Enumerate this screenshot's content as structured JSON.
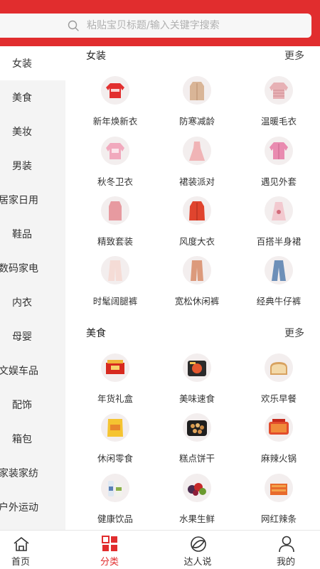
{
  "colors": {
    "accent": "#e12d2e",
    "sidebar_bg": "#f4f4f4"
  },
  "search": {
    "placeholder": "粘贴宝贝标题/输入关键字搜索"
  },
  "sidebar": {
    "items": [
      {
        "label": "女装",
        "active": true
      },
      {
        "label": "美食"
      },
      {
        "label": "美妆"
      },
      {
        "label": "男装"
      },
      {
        "label": "居家日用"
      },
      {
        "label": "鞋品"
      },
      {
        "label": "数码家电"
      },
      {
        "label": "内衣"
      },
      {
        "label": "母婴"
      },
      {
        "label": "文娱车品"
      },
      {
        "label": "配饰"
      },
      {
        "label": "箱包"
      },
      {
        "label": "家装家纺"
      },
      {
        "label": "户外运动"
      }
    ]
  },
  "sections": [
    {
      "title": "女装",
      "more": "更多",
      "items": [
        {
          "label": "新年焕新衣",
          "icon": "red-sweater-icon"
        },
        {
          "label": "防寒减龄",
          "icon": "beige-coat-icon"
        },
        {
          "label": "温暖毛衣",
          "icon": "pink-knit-sweater-icon"
        },
        {
          "label": "秋冬卫衣",
          "icon": "pink-hoodie-icon"
        },
        {
          "label": "裙装派对",
          "icon": "pink-dress-icon"
        },
        {
          "label": "遇见外套",
          "icon": "pink-jacket-icon"
        },
        {
          "label": "精致套装",
          "icon": "pink-suit-icon"
        },
        {
          "label": "风度大衣",
          "icon": "red-coat-icon"
        },
        {
          "label": "百搭半身裙",
          "icon": "pink-skirt-icon"
        },
        {
          "label": "时髦阔腿裤",
          "icon": "wide-leg-pants-icon"
        },
        {
          "label": "宽松休闲裤",
          "icon": "casual-pants-icon"
        },
        {
          "label": "经典牛仔裤",
          "icon": "jeans-icon"
        }
      ]
    },
    {
      "title": "美食",
      "more": "更多",
      "items": [
        {
          "label": "年货礼盒",
          "icon": "gift-box-icon"
        },
        {
          "label": "美味速食",
          "icon": "instant-food-icon"
        },
        {
          "label": "欢乐早餐",
          "icon": "bread-icon"
        },
        {
          "label": "休闲零食",
          "icon": "snack-bag-icon"
        },
        {
          "label": "糕点饼干",
          "icon": "cookies-icon"
        },
        {
          "label": "麻辣火锅",
          "icon": "hotpot-icon"
        },
        {
          "label": "健康饮品",
          "icon": "drink-bottles-icon"
        },
        {
          "label": "水果生鲜",
          "icon": "fruit-icon"
        },
        {
          "label": "网红辣条",
          "icon": "spicy-strips-icon"
        }
      ]
    }
  ],
  "tabbar": {
    "items": [
      {
        "label": "首页",
        "icon": "home-icon"
      },
      {
        "label": "分类",
        "icon": "category-grid-icon",
        "active": true
      },
      {
        "label": "达人说",
        "icon": "planet-icon"
      },
      {
        "label": "我的",
        "icon": "user-icon"
      }
    ]
  }
}
